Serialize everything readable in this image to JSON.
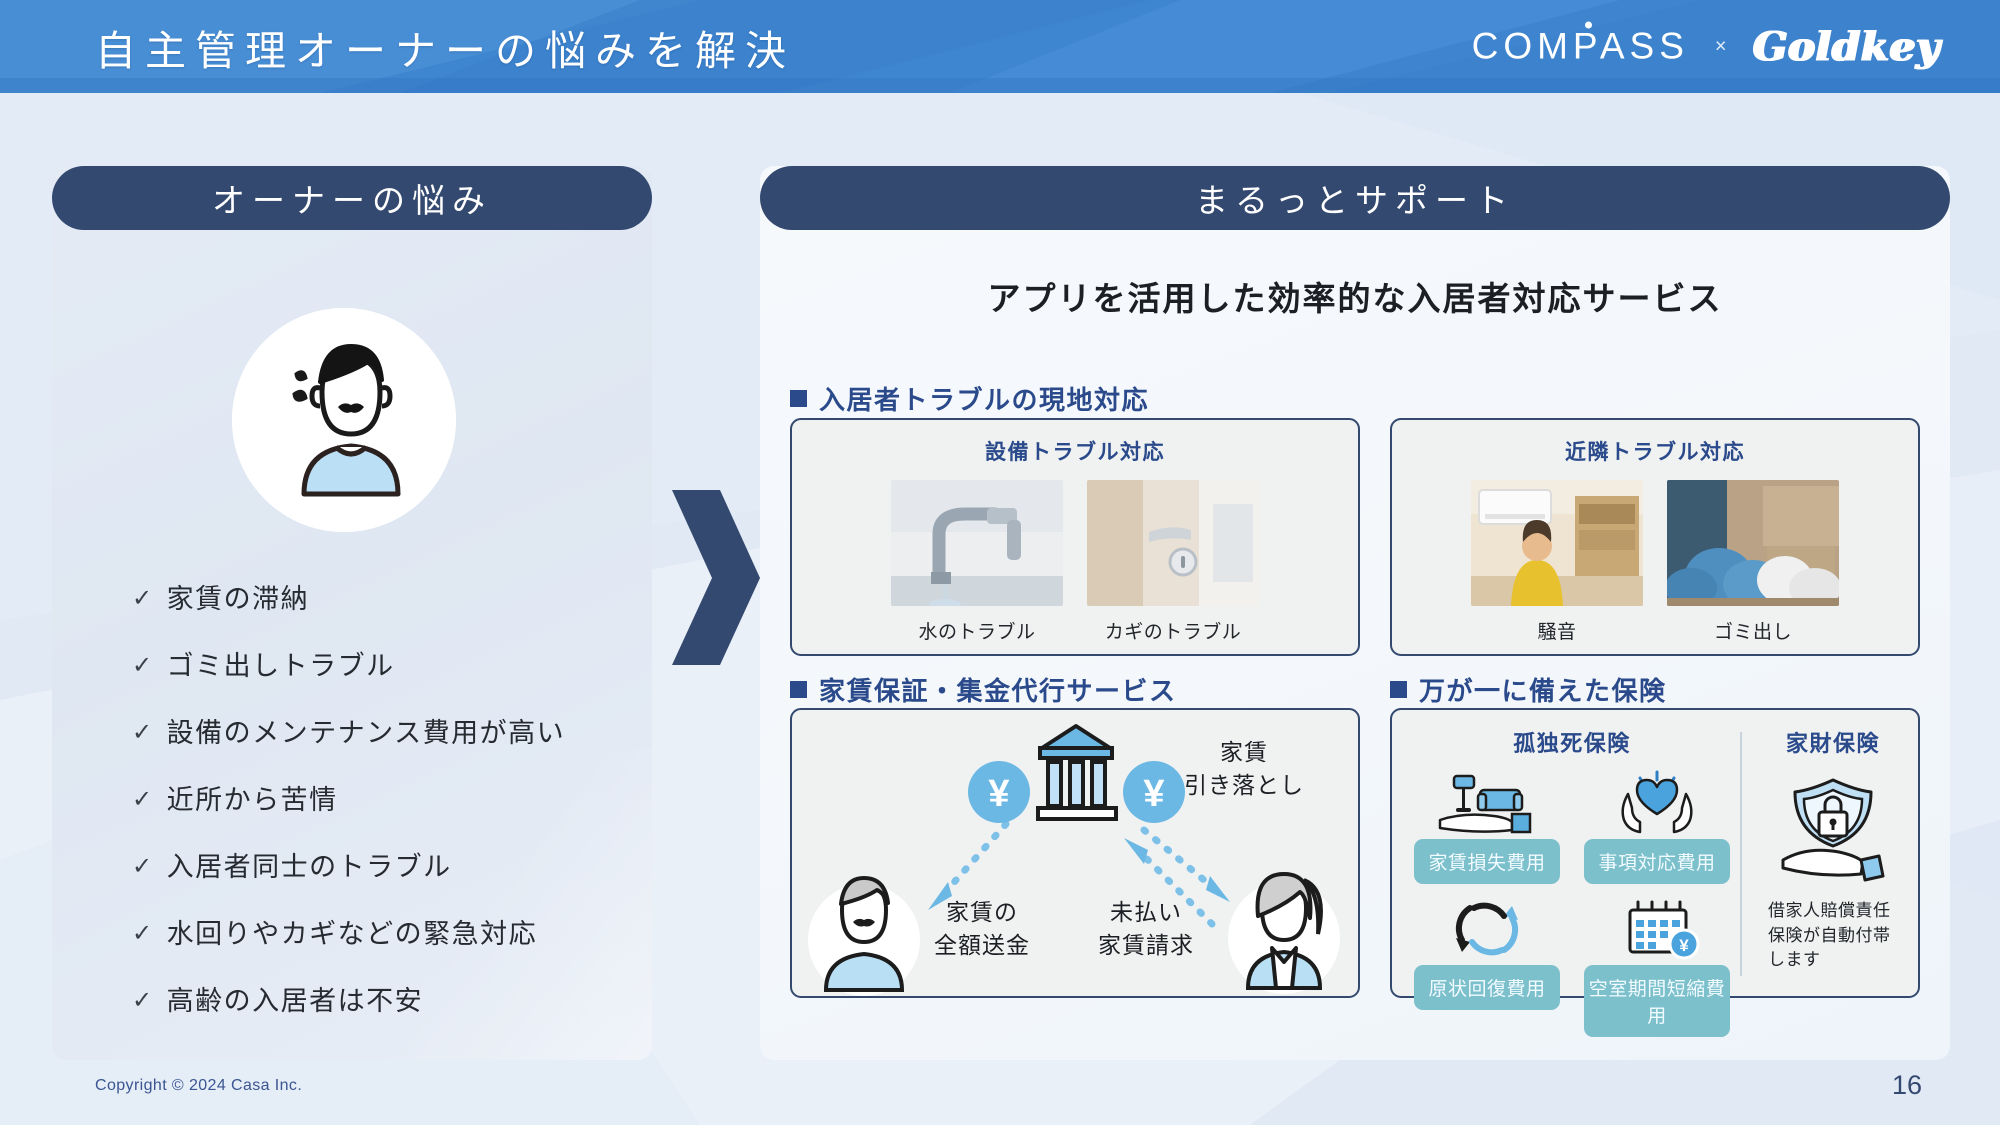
{
  "header": {
    "title": "自主管理オーナーの悩みを解決",
    "logo_compass": "COMPASS",
    "logo_separator": "×",
    "logo_goldkey": "Goldkey"
  },
  "left_panel": {
    "heading": "オーナーの悩み",
    "avatar_icon": "worried-owner-avatar",
    "issues": [
      {
        "check": "✓",
        "text": "家賃の滞納"
      },
      {
        "check": "✓",
        "text": "ゴミ出しトラブル"
      },
      {
        "check": "✓",
        "text": "設備のメンテナンス費用が高い"
      },
      {
        "check": "✓",
        "text": "近所から苦情"
      },
      {
        "check": "✓",
        "text": "入居者同士のトラブル"
      },
      {
        "check": "✓",
        "text": "水回りやカギなどの緊急対応"
      },
      {
        "check": "✓",
        "text": "高齢の入居者は不安"
      }
    ]
  },
  "right_panel": {
    "heading": "まるっとサポート",
    "subtitle": "アプリを活用した効率的な入居者対応サービス",
    "section_trouble": {
      "label": "入居者トラブルの現地対応",
      "cards": [
        {
          "title": "設備トラブル対応",
          "items": [
            {
              "caption": "水のトラブル",
              "icon": "faucet-photo"
            },
            {
              "caption": "カギのトラブル",
              "icon": "door-lock-photo"
            }
          ]
        },
        {
          "title": "近隣トラブル対応",
          "items": [
            {
              "caption": "騒音",
              "icon": "noise-photo"
            },
            {
              "caption": "ゴミ出し",
              "icon": "garbage-photo"
            }
          ]
        }
      ]
    },
    "section_guarantee": {
      "label": "家賃保証・集金代行サービス",
      "diagram": {
        "bank_icon": "bank-building-icon",
        "yen_left": "¥",
        "yen_right": "¥",
        "owner_icon": "owner-avatar",
        "tenant_icon": "tenant-avatar",
        "label_withdraw": "家賃\n引き落とし",
        "label_withdraw_line1": "家賃",
        "label_withdraw_line2": "引き落とし",
        "label_remit_line1": "家賃の",
        "label_remit_line2": "全額送金",
        "label_claim_line1": "未払い",
        "label_claim_line2": "家賃請求"
      }
    },
    "section_insurance": {
      "label": "万が一に備えた保険",
      "col_lonely_death": {
        "title": "孤独死保険",
        "badges": [
          {
            "label": "家賃損失費用",
            "icon": "furniture-on-hand-icon"
          },
          {
            "label": "事項対応費用",
            "icon": "heart-in-hands-icon"
          },
          {
            "label": "原状回復費用",
            "icon": "recycle-arrows-icon"
          },
          {
            "label": "空室期間短縮費用",
            "icon": "calendar-yen-icon"
          }
        ]
      },
      "col_property": {
        "title": "家財保険",
        "icon": "shield-lock-on-hand-icon",
        "note": "借家人賠償責任\n保険が自動付帯\nします",
        "note_line1": "借家人賠償責任",
        "note_line2": "保険が自動付帯",
        "note_line3": "します"
      }
    }
  },
  "footer": {
    "copyright": "Copyright © 2024 Casa Inc.",
    "page_number": "16"
  },
  "colors": {
    "header_blue": "#3f86d0",
    "navy": "#34496f",
    "accent_blue": "#2a4a8b",
    "badge_teal": "#7cc0cc",
    "light_blue": "#bcdcf5",
    "panel_bg": "#e8eef7"
  }
}
